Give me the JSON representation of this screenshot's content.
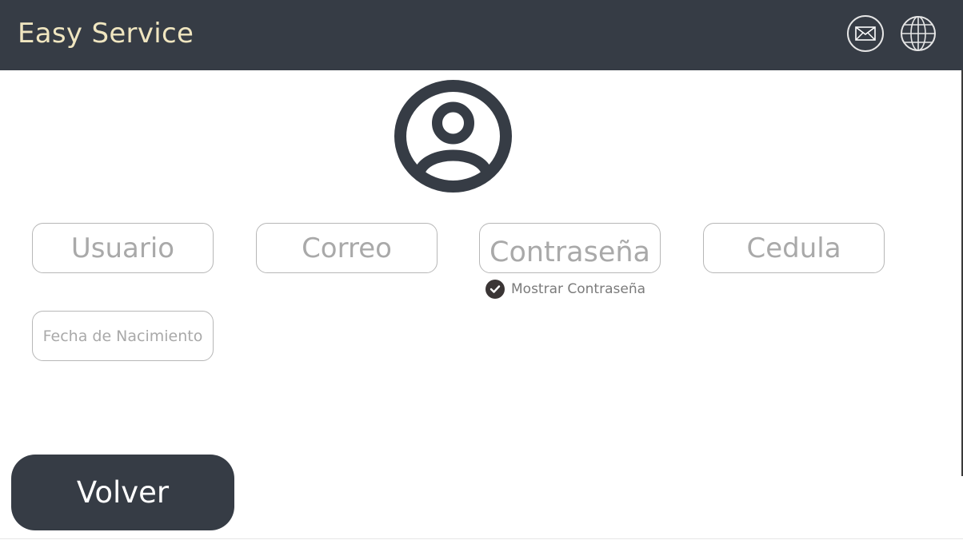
{
  "app": {
    "title": "Easy Service"
  },
  "header": {
    "icons": [
      "mail-icon",
      "globe-icon"
    ]
  },
  "form": {
    "usuario_placeholder": "Usuario",
    "correo_placeholder": "Correo",
    "password_placeholder": "Contraseña",
    "cedula_placeholder": "Cedula",
    "fecha_placeholder": "Fecha de Nacimiento",
    "show_password_label": "Mostrar Contraseña",
    "show_password_checked": true
  },
  "actions": {
    "back_label": "Volver"
  },
  "colors": {
    "header_bg": "#363c45",
    "title_color": "#f0e6c0",
    "button_bg": "#363c45",
    "placeholder": "#a9a9a9"
  }
}
